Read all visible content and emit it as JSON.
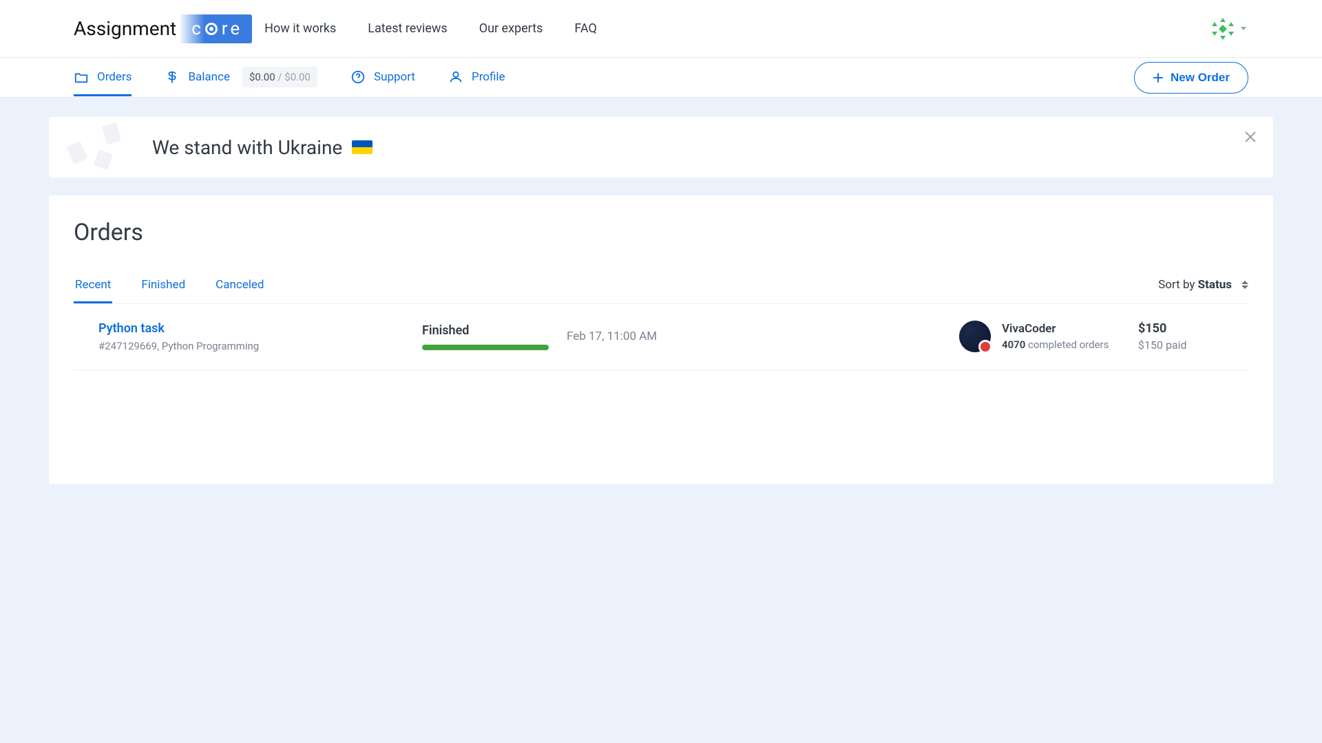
{
  "header": {
    "logo": {
      "left": "Assignment",
      "right_c": "c",
      "right_re": "re"
    },
    "nav": [
      "How it works",
      "Latest reviews",
      "Our experts",
      "FAQ"
    ]
  },
  "subnav": {
    "orders": "Orders",
    "balance_label": "Balance",
    "balance_main": "$0.00",
    "balance_sep": " / ",
    "balance_muted": "$0.00",
    "support": "Support",
    "profile": "Profile",
    "new_order": "New Order"
  },
  "banner": {
    "title": "We stand with Ukraine"
  },
  "orders_card": {
    "title": "Orders",
    "tabs": [
      "Recent",
      "Finished",
      "Canceled"
    ],
    "sort_prefix": "Sort by ",
    "sort_field": "Status",
    "rows": [
      {
        "title": "Python task",
        "sub": "#247129669, Python Programming",
        "status": "Finished",
        "progress_pct": 100,
        "date": "Feb 17, 11:00 AM",
        "expert_name": "VivaCoder",
        "expert_count": "4070",
        "expert_count_suffix": " completed orders",
        "price": "$150",
        "paid": "$150 paid"
      }
    ]
  }
}
